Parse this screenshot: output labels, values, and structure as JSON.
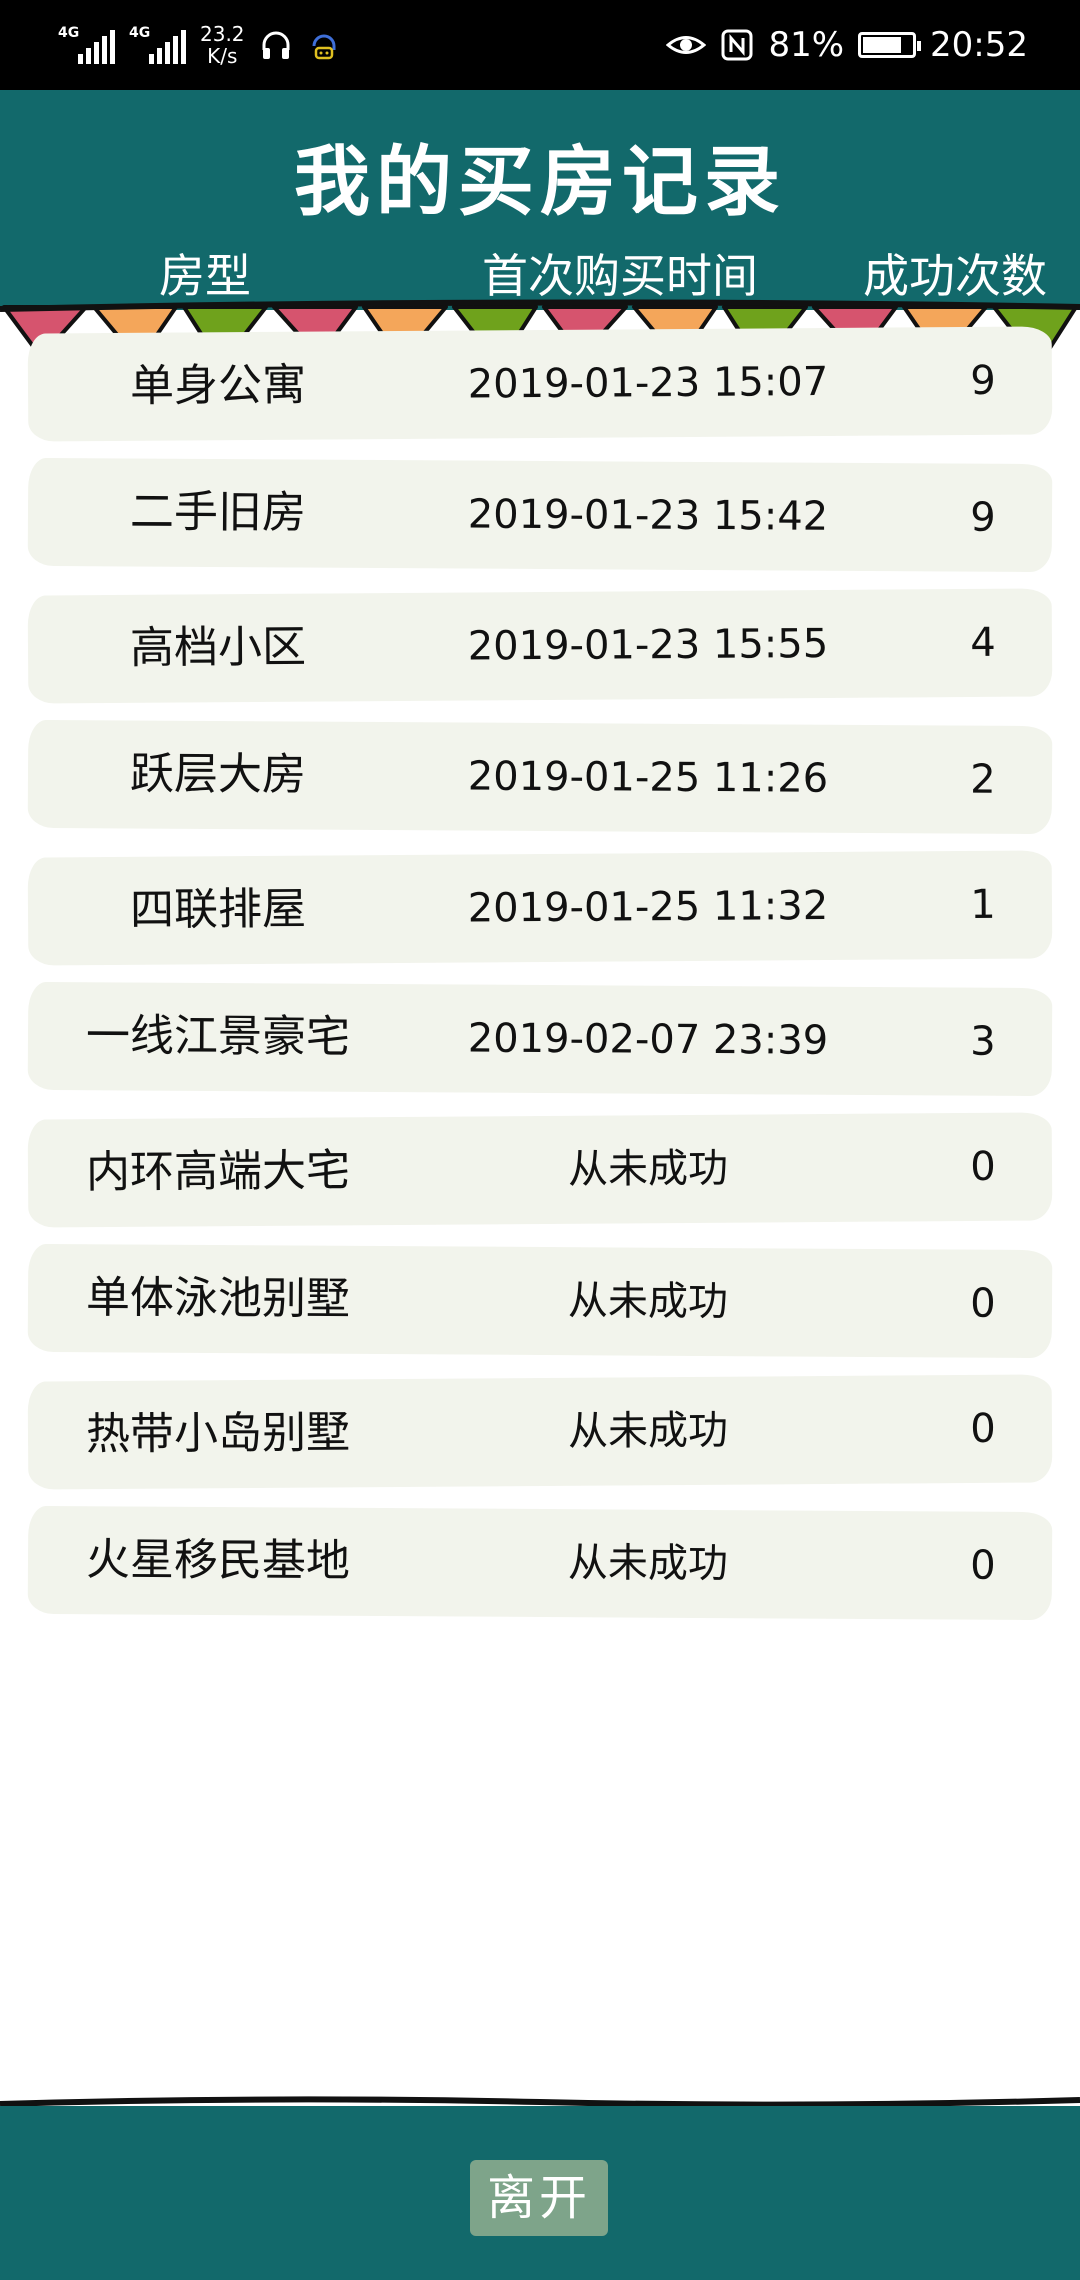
{
  "status_bar": {
    "network_1": "4G",
    "network_2": "4G",
    "speed_value": "23.2",
    "speed_unit": "K/s",
    "battery": "81%",
    "battery_level": 0.81,
    "time": "20:52"
  },
  "header": {
    "title": "我的买房记录",
    "columns": {
      "type": "房型",
      "first_purchase": "首次购买时间",
      "success_count": "成功次数"
    }
  },
  "records": [
    {
      "type": "单身公寓",
      "time": "2019-01-23 15:07",
      "count": "9"
    },
    {
      "type": "二手旧房",
      "time": "2019-01-23 15:42",
      "count": "9"
    },
    {
      "type": "高档小区",
      "time": "2019-01-23 15:55",
      "count": "4"
    },
    {
      "type": "跃层大房",
      "time": "2019-01-25 11:26",
      "count": "2"
    },
    {
      "type": "四联排屋",
      "time": "2019-01-25 11:32",
      "count": "1"
    },
    {
      "type": "一线江景豪宅",
      "time": "2019-02-07 23:39",
      "count": "3"
    },
    {
      "type": "内环高端大宅",
      "time": "从未成功",
      "count": "0"
    },
    {
      "type": "单体泳池别墅",
      "time": "从未成功",
      "count": "0"
    },
    {
      "type": "热带小岛别墅",
      "time": "从未成功",
      "count": "0"
    },
    {
      "type": "火星移民基地",
      "time": "从未成功",
      "count": "0"
    }
  ],
  "footer": {
    "leave_label": "离开"
  },
  "colors": {
    "header_bg": "#12696b",
    "row_bg": "#f2f4ec",
    "flag_pink": "#d6546e",
    "flag_orange": "#f4a65a",
    "flag_green": "#6fa21c",
    "button_bg": "#7ea48a"
  }
}
